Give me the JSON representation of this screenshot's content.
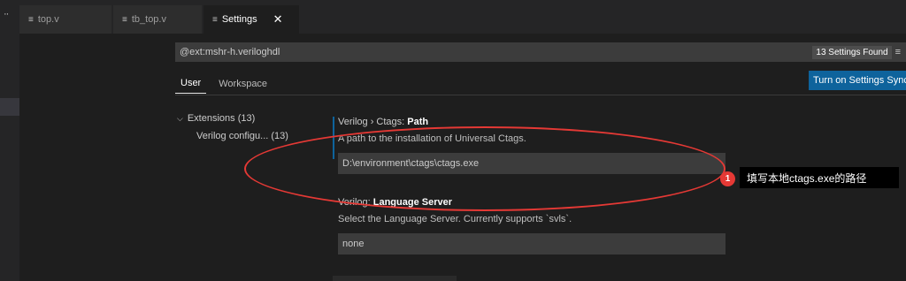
{
  "tabs": [
    {
      "label": "top.v",
      "icon": "≡"
    },
    {
      "label": "tb_top.v",
      "icon": "≡"
    },
    {
      "label": "Settings",
      "icon": "≡",
      "close": "✕"
    }
  ],
  "activity": {
    "dots": "··"
  },
  "search": {
    "query": "@ext:mshr-h.veriloghdl",
    "count_badge": "13 Settings Found",
    "filter_icon": "≡"
  },
  "scope_tabs": {
    "user": "User",
    "workspace": "Workspace"
  },
  "sync_button": "Turn on Settings Sync",
  "toc": {
    "extensions": "Extensions (13)",
    "verilog": "Verilog configu... (13)",
    "chevron": "⌵"
  },
  "settings": [
    {
      "category": "Verilog › Ctags: ",
      "name": "Path",
      "description": "A path to the installation of Universal Ctags.",
      "value": "D:\\environment\\ctags\\ctags.exe"
    },
    {
      "category": "Verilog: ",
      "name": "Language Server",
      "description": "Select the Language Server. Currently supports `svls`.",
      "value": "none"
    }
  ],
  "annotation": {
    "number": "1",
    "text": "填写本地ctags.exe的路径",
    "color": "#e53935"
  },
  "colors": {
    "accent": "#0e639c",
    "background": "#1e1e1e"
  }
}
